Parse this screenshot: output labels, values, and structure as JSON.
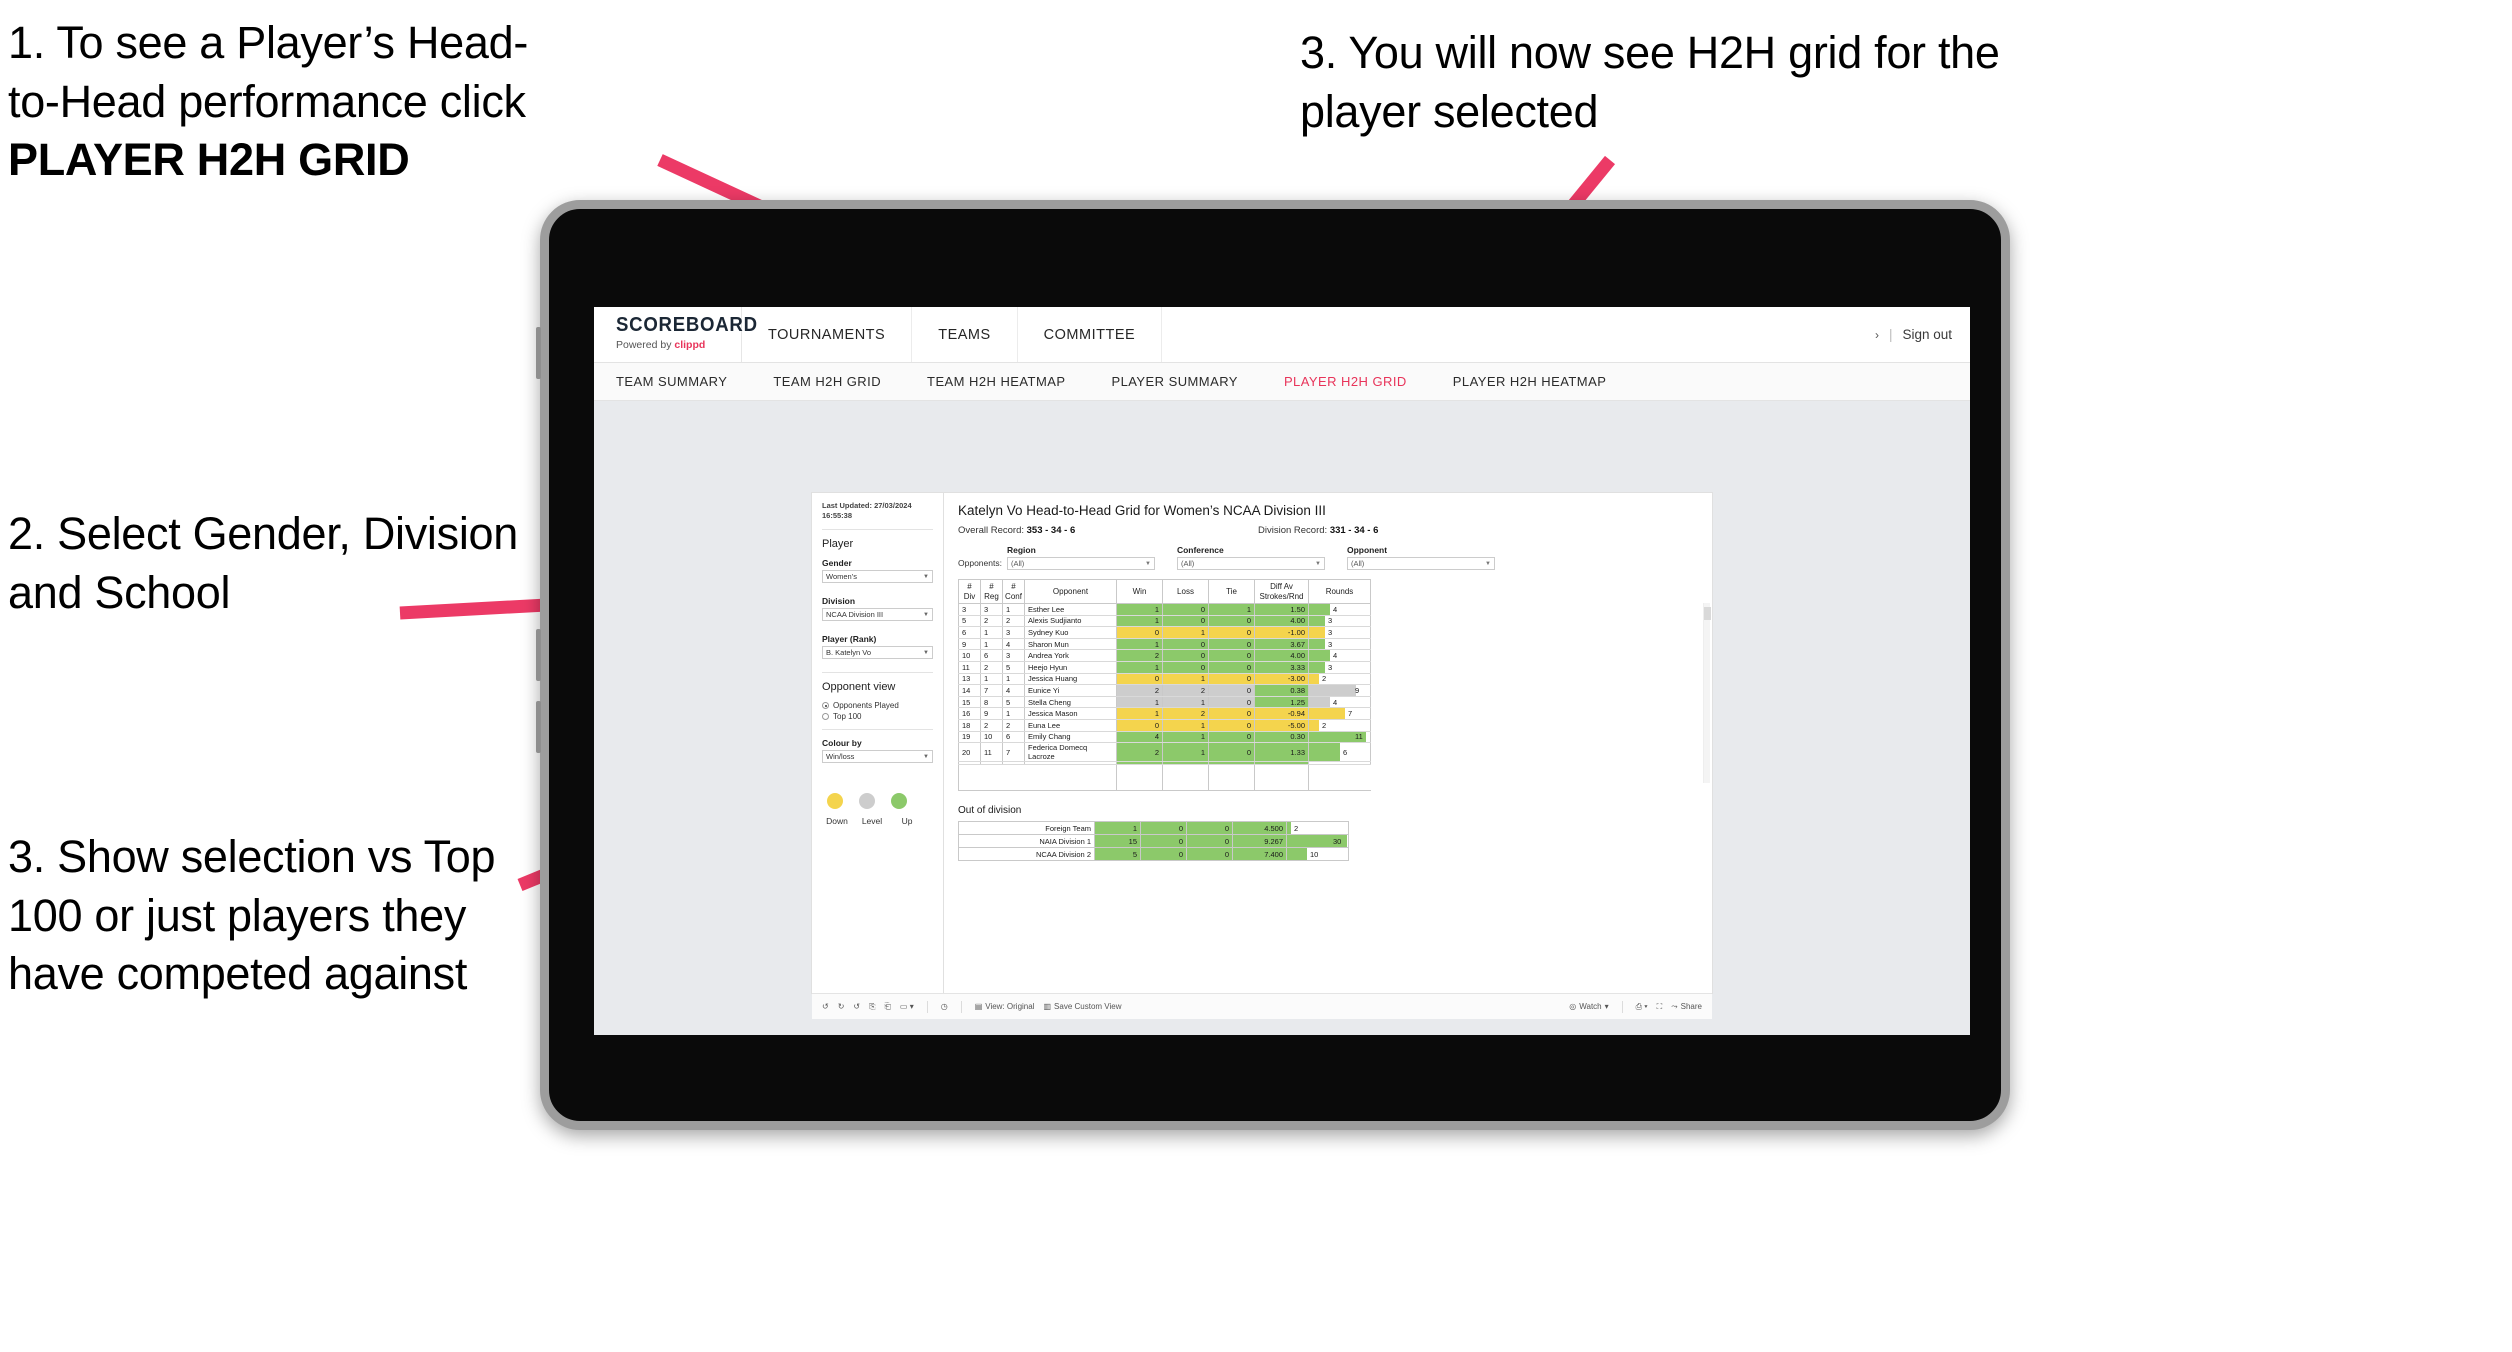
{
  "annotations": {
    "a1_line1": "1. To see a Player’s Head-",
    "a1_line2": "to-Head performance click",
    "a1_bold": "PLAYER H2H GRID",
    "a2": "2. Select Gender, Division and School",
    "a3": "3. Show selection vs Top 100 or just players they have competed against",
    "a4": "3. You will now see H2H grid for the player selected"
  },
  "brand": {
    "name": "SCOREBOARD",
    "powered_prefix": "Powered by ",
    "powered_brand": "clippd"
  },
  "topnav": {
    "items": [
      "TOURNAMENTS",
      "TEAMS",
      "COMMITTEE"
    ],
    "signout": "Sign out",
    "separator": "|",
    "chevron": "›"
  },
  "subnav": {
    "items": [
      "TEAM SUMMARY",
      "TEAM H2H GRID",
      "TEAM H2H HEATMAP",
      "PLAYER SUMMARY",
      "PLAYER H2H GRID",
      "PLAYER H2H HEATMAP"
    ],
    "active": "PLAYER H2H GRID"
  },
  "filters": {
    "last_updated": "Last Updated: 27/03/2024 16:55:38",
    "player_heading": "Player",
    "gender_label": "Gender",
    "gender_value": "Women’s",
    "division_label": "Division",
    "division_value": "NCAA Division III",
    "player_label": "Player (Rank)",
    "player_value": "B. Katelyn Vo",
    "opponent_view_heading": "Opponent view",
    "opponent_view_options": [
      "Opponents Played",
      "Top 100"
    ],
    "opponent_view_selected": "Opponents Played",
    "colour_by_label": "Colour by",
    "colour_by_value": "Win/loss",
    "legend": [
      {
        "label": "Down",
        "color": "#f4d44d"
      },
      {
        "label": "Level",
        "color": "#cdcdcd"
      },
      {
        "label": "Up",
        "color": "#8cc96a"
      }
    ]
  },
  "main": {
    "title": "Katelyn Vo Head-to-Head Grid for Women’s NCAA Division III",
    "overall_record_label": "Overall Record:",
    "overall_record_value": "353 - 34 - 6",
    "division_record_label": "Division Record:",
    "division_record_value": "331 - 34 - 6",
    "opponents_label": "Opponents:",
    "opponent_filters": [
      {
        "label": "Region",
        "value": "(All)"
      },
      {
        "label": "Conference",
        "value": "(All)"
      },
      {
        "label": "Opponent",
        "value": "(All)"
      }
    ],
    "out_of_division_title": "Out of division"
  },
  "chart_data": {
    "type": "table",
    "title": "Katelyn Vo Head-to-Head Grid for Women’s NCAA Division III",
    "columns": [
      "# Div",
      "# Reg",
      "# Conf",
      "Opponent",
      "Win",
      "Loss",
      "Tie",
      "Diff Av Strokes/Rnd",
      "Rounds"
    ],
    "column_header_lines": [
      [
        "#",
        "Div"
      ],
      [
        "#",
        "Reg"
      ],
      [
        "#",
        "Conf"
      ],
      [
        "Opponent",
        ""
      ],
      [
        "Win",
        ""
      ],
      [
        "Loss",
        ""
      ],
      [
        "Tie",
        ""
      ],
      [
        "Diff Av",
        "Strokes/Rnd"
      ],
      [
        "Rounds",
        ""
      ]
    ],
    "rows": [
      {
        "div": "3",
        "reg": "3",
        "conf": "1",
        "opponent": "Esther Lee",
        "win": "1",
        "loss": "0",
        "tie": "1",
        "diff": "1.50",
        "rounds": "4",
        "rounds_n": 4,
        "state": "up"
      },
      {
        "div": "5",
        "reg": "2",
        "conf": "2",
        "opponent": "Alexis Sudjianto",
        "win": "1",
        "loss": "0",
        "tie": "0",
        "diff": "4.00",
        "rounds": "3",
        "rounds_n": 3,
        "state": "up"
      },
      {
        "div": "6",
        "reg": "1",
        "conf": "3",
        "opponent": "Sydney Kuo",
        "win": "0",
        "loss": "1",
        "tie": "0",
        "diff": "-1.00",
        "rounds": "3",
        "rounds_n": 3,
        "state": "down"
      },
      {
        "div": "9",
        "reg": "1",
        "conf": "4",
        "opponent": "Sharon Mun",
        "win": "1",
        "loss": "0",
        "tie": "0",
        "diff": "3.67",
        "rounds": "3",
        "rounds_n": 3,
        "state": "up"
      },
      {
        "div": "10",
        "reg": "6",
        "conf": "3",
        "opponent": "Andrea York",
        "win": "2",
        "loss": "0",
        "tie": "0",
        "diff": "4.00",
        "rounds": "4",
        "rounds_n": 4,
        "state": "up"
      },
      {
        "div": "11",
        "reg": "2",
        "conf": "5",
        "opponent": "Heejo Hyun",
        "win": "1",
        "loss": "0",
        "tie": "0",
        "diff": "3.33",
        "rounds": "3",
        "rounds_n": 3,
        "state": "up"
      },
      {
        "div": "13",
        "reg": "1",
        "conf": "1",
        "opponent": "Jessica Huang",
        "win": "0",
        "loss": "1",
        "tie": "0",
        "diff": "-3.00",
        "rounds": "2",
        "rounds_n": 2,
        "state": "down"
      },
      {
        "div": "14",
        "reg": "7",
        "conf": "4",
        "opponent": "Eunice Yi",
        "win": "2",
        "loss": "2",
        "tie": "0",
        "diff": "0.38",
        "rounds": "9",
        "rounds_n": 9,
        "state": "level",
        "diff_state": "up"
      },
      {
        "div": "15",
        "reg": "8",
        "conf": "5",
        "opponent": "Stella Cheng",
        "win": "1",
        "loss": "1",
        "tie": "0",
        "diff": "1.25",
        "rounds": "4",
        "rounds_n": 4,
        "state": "level",
        "diff_state": "up"
      },
      {
        "div": "16",
        "reg": "9",
        "conf": "1",
        "opponent": "Jessica Mason",
        "win": "1",
        "loss": "2",
        "tie": "0",
        "diff": "-0.94",
        "rounds": "7",
        "rounds_n": 7,
        "state": "down"
      },
      {
        "div": "18",
        "reg": "2",
        "conf": "2",
        "opponent": "Euna Lee",
        "win": "0",
        "loss": "1",
        "tie": "0",
        "diff": "-5.00",
        "rounds": "2",
        "rounds_n": 2,
        "state": "down"
      },
      {
        "div": "19",
        "reg": "10",
        "conf": "6",
        "opponent": "Emily Chang",
        "win": "4",
        "loss": "1",
        "tie": "0",
        "diff": "0.30",
        "rounds": "11",
        "rounds_n": 11,
        "state": "up"
      },
      {
        "div": "20",
        "reg": "11",
        "conf": "7",
        "opponent": "Federica Domecq Lacroze",
        "win": "2",
        "loss": "1",
        "tie": "0",
        "diff": "1.33",
        "rounds": "6",
        "rounds_n": 6,
        "state": "up"
      }
    ],
    "rounds_max": 12,
    "out_of_division": [
      {
        "name": "Foreign Team",
        "win": "1",
        "loss": "0",
        "tie": "0",
        "diff": "4.500",
        "rounds": "2",
        "rounds_n": 2,
        "state": "up"
      },
      {
        "name": "NAIA Division 1",
        "win": "15",
        "loss": "0",
        "tie": "0",
        "diff": "9.267",
        "rounds": "30",
        "rounds_n": 30,
        "state": "up"
      },
      {
        "name": "NCAA Division 2",
        "win": "5",
        "loss": "0",
        "tie": "0",
        "diff": "7.400",
        "rounds": "10",
        "rounds_n": 10,
        "state": "up"
      }
    ],
    "ood_rounds_max": 31,
    "colors": {
      "up": "#8cc96a",
      "down": "#f4d44d",
      "level": "#cdcdcd",
      "accent": "#e8345a"
    }
  },
  "toolbar": {
    "view_label": "View: Original",
    "save_label": "Save Custom View",
    "watch_label": "Watch",
    "share_label": "Share"
  }
}
